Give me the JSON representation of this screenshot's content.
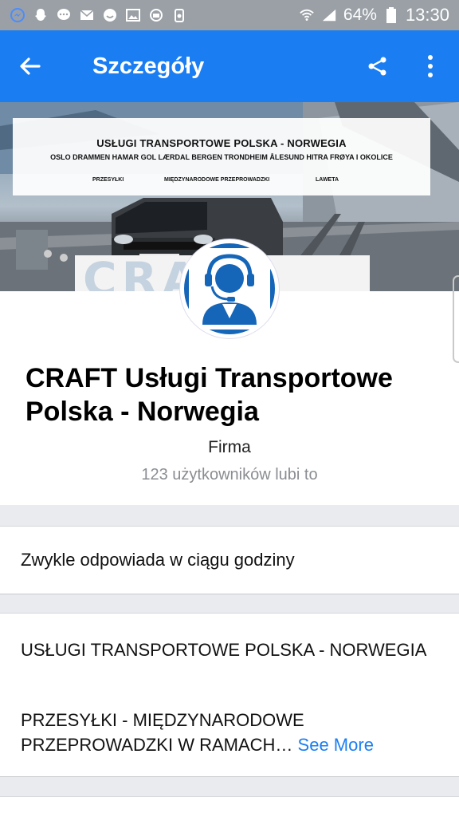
{
  "status_bar": {
    "battery": "64%",
    "time": "13:30"
  },
  "app_bar": {
    "title": "Szczegóły",
    "icons": [
      "back-arrow-icon",
      "share-icon",
      "more-vert-icon"
    ]
  },
  "cover": {
    "banner_title": "USŁUGI TRANSPORTOWE POLSKA - NORWEGIA",
    "banner_cities": "OSLO DRAMMEN HAMAR GOL LÆRDAL BERGEN TRONDHEIM ÅLESUND HITRA FRØYA I OKOLICE",
    "banner_left": "PRZESYŁKI",
    "banner_middle": "MIĘDZYNARODOWE PRZEPROWADZKI",
    "banner_right": "LAWETA",
    "watermark": "CRAFT"
  },
  "profile": {
    "name": "CRAFT  Usługi Transportowe Polska - Norwegia",
    "category": "Firma",
    "likes": "123 użytkowników lubi to"
  },
  "response": {
    "text": "Zwykle odpowiada w ciągu godziny"
  },
  "about": {
    "line1": "USŁUGI TRANSPORTOWE POLSKA - NORWEGIA",
    "line2": "PRZESYŁKI - MIĘDZYNARODOWE PRZEPROWADZKI W RAMACH…",
    "see_more": "See More"
  },
  "colors": {
    "accent": "#1a7ef2",
    "status_bar": "#9aa0a6"
  }
}
